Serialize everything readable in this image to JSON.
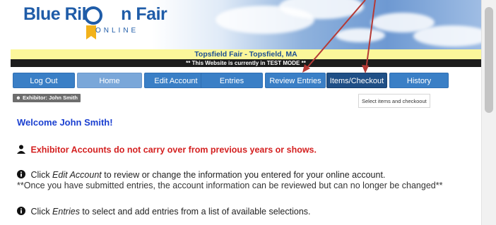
{
  "logo": {
    "text_left": "Blue Ribb",
    "text_right": "n Fair",
    "subtitle": "ONLINE"
  },
  "banner": {
    "fair_title": "Topsfield Fair - Topsfield, MA",
    "test_mode": "** This Website is currently in TEST MODE **"
  },
  "nav": {
    "items": [
      {
        "label": "Log Out"
      },
      {
        "label": "Home"
      },
      {
        "label": "Edit Account"
      },
      {
        "label": "Entries"
      },
      {
        "label": "Review Entries"
      },
      {
        "label": "Items/Checkout"
      },
      {
        "label": "History"
      }
    ]
  },
  "exhibitor": {
    "label": "Exhibitor: John Smith"
  },
  "checkout_search": {
    "value": "Select items and checkoout"
  },
  "content": {
    "welcome": "Welcome John Smith!",
    "warning": "Exhibitor Accounts do not carry over from previous years or shows.",
    "info1_prefix": "Click ",
    "info1_link": "Edit Account",
    "info1_suffix": " to review or change the information you entered for your online account.",
    "info2": "**Once you have submitted entries, the account information can be reviewed but can no longer be changed**",
    "info3_prefix": "Click ",
    "info3_link": "Entries",
    "info3_suffix": " to select and add entries from a list of available selections."
  },
  "colors": {
    "nav_blue": "#3a7fc6",
    "nav_active": "#1f4f86",
    "warning_red": "#d42020",
    "welcome_blue": "#1a3fd0",
    "annotation_arrow": "#b53a36"
  },
  "icons": [
    "user-icon",
    "info-icon",
    "ribbon-icon"
  ]
}
